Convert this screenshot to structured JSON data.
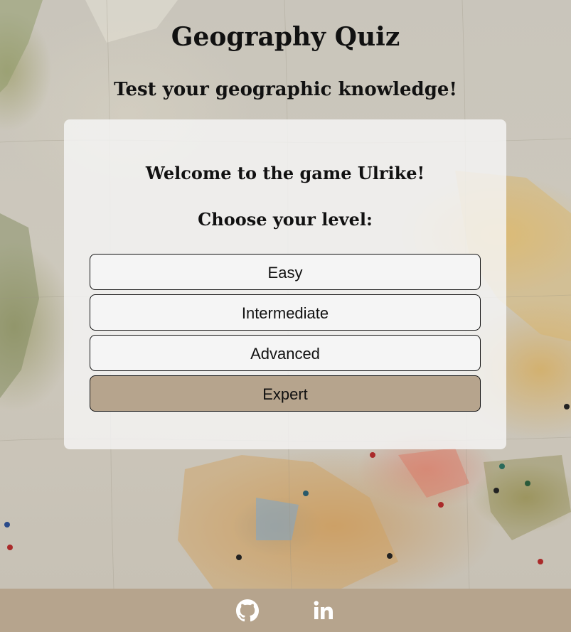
{
  "header": {
    "title": "Geography Quiz",
    "subtitle": "Test your geographic knowledge!"
  },
  "panel": {
    "welcome": "Welcome to the game Ulrike!",
    "level_heading": "Choose your level:",
    "levels": [
      {
        "label": "Easy",
        "selected": false
      },
      {
        "label": "Intermediate",
        "selected": false
      },
      {
        "label": "Advanced",
        "selected": false
      },
      {
        "label": "Expert",
        "selected": true
      }
    ]
  },
  "footer": {
    "links": [
      {
        "icon": "github-icon"
      },
      {
        "icon": "linkedin-icon"
      }
    ]
  },
  "colors": {
    "accent": "#b6a48d",
    "button_bg": "#f5f5f5",
    "text": "#111111"
  }
}
